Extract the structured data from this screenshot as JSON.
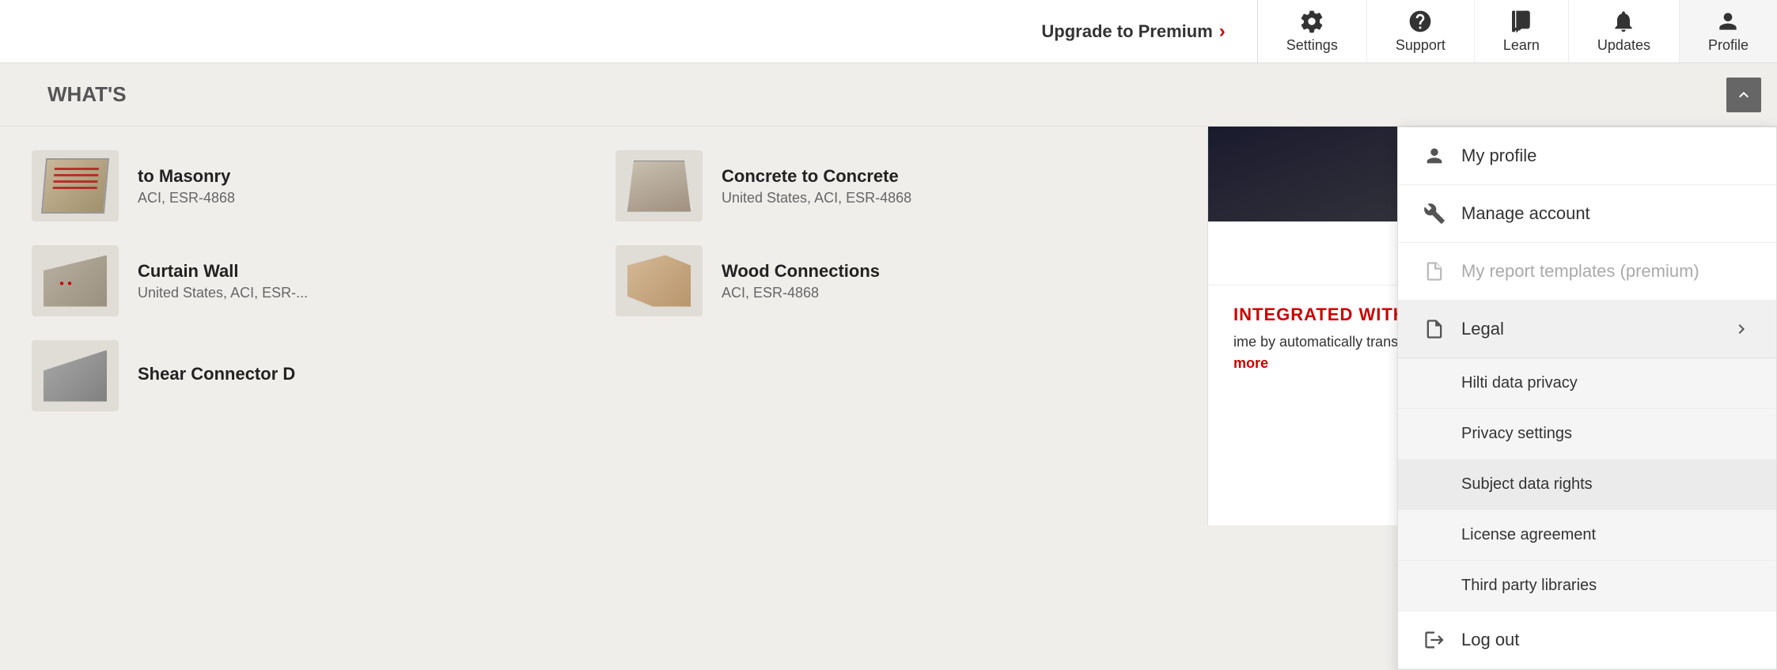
{
  "nav": {
    "upgrade_label": "Upgrade to Premium",
    "settings_label": "Settings",
    "support_label": "Support",
    "learn_label": "Learn",
    "updates_label": "Updates",
    "profile_label": "Profile"
  },
  "dropdown": {
    "my_profile": "My profile",
    "manage_account": "Manage account",
    "my_report_templates": "My report templates (premium)",
    "legal": "Legal",
    "hilti_data_privacy": "Hilti data privacy",
    "privacy_settings": "Privacy settings",
    "subject_data_rights": "Subject data rights",
    "license_agreement": "License agreement",
    "third_party_libraries": "Third party libraries",
    "log_out": "Log out"
  },
  "connections": [
    {
      "title": "to Masonry",
      "subtitle": "ACI, ESR-4868"
    },
    {
      "title": "Concrete to Concrete",
      "subtitle": "United States, ACI, ESR-4868"
    },
    {
      "title": "Curtain Wall",
      "subtitle": "United States, ACI, ESR-..."
    },
    {
      "title": "Wood Connections",
      "subtitle": "ACI, ESR-4868"
    },
    {
      "title": "Shear Connector D",
      "subtitle": ""
    }
  ],
  "whats_new": "WHAT'S",
  "promo": {
    "title": "INTEGRATED WITH RAM UCTURAL SYSTEM",
    "text": "ime by automatically transferring oundation designs to PROFIS ering.",
    "link_label": "Learn more"
  }
}
